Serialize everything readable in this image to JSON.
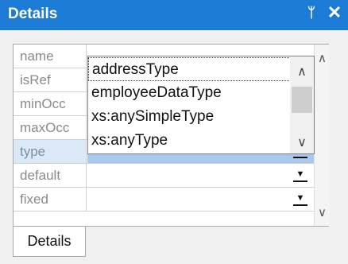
{
  "window": {
    "title": "Details",
    "pin_glyph": "ᛘ",
    "close_glyph": "✕"
  },
  "properties": [
    {
      "label": "name",
      "value": ""
    },
    {
      "label": "isRef",
      "value": ""
    },
    {
      "label": "minOcc",
      "value": ""
    },
    {
      "label": "maxOcc",
      "value": ""
    },
    {
      "label": "type",
      "value": "",
      "selected": true
    },
    {
      "label": "default",
      "value": ""
    },
    {
      "label": "fixed",
      "value": ""
    }
  ],
  "dropdown": {
    "options": [
      {
        "label": "addressType",
        "focused": true
      },
      {
        "label": "employeeDataType"
      },
      {
        "label": "xs:anySimpleType"
      },
      {
        "label": "xs:anyType"
      }
    ],
    "scrollbar_position_fraction": 0.3
  },
  "tabs": [
    {
      "label": "Details",
      "active": true
    }
  ],
  "colors": {
    "titlebar": "#1c7bd5",
    "selected_row": "#a8c8ee",
    "selected_label_bg": "#dbe8f7"
  }
}
